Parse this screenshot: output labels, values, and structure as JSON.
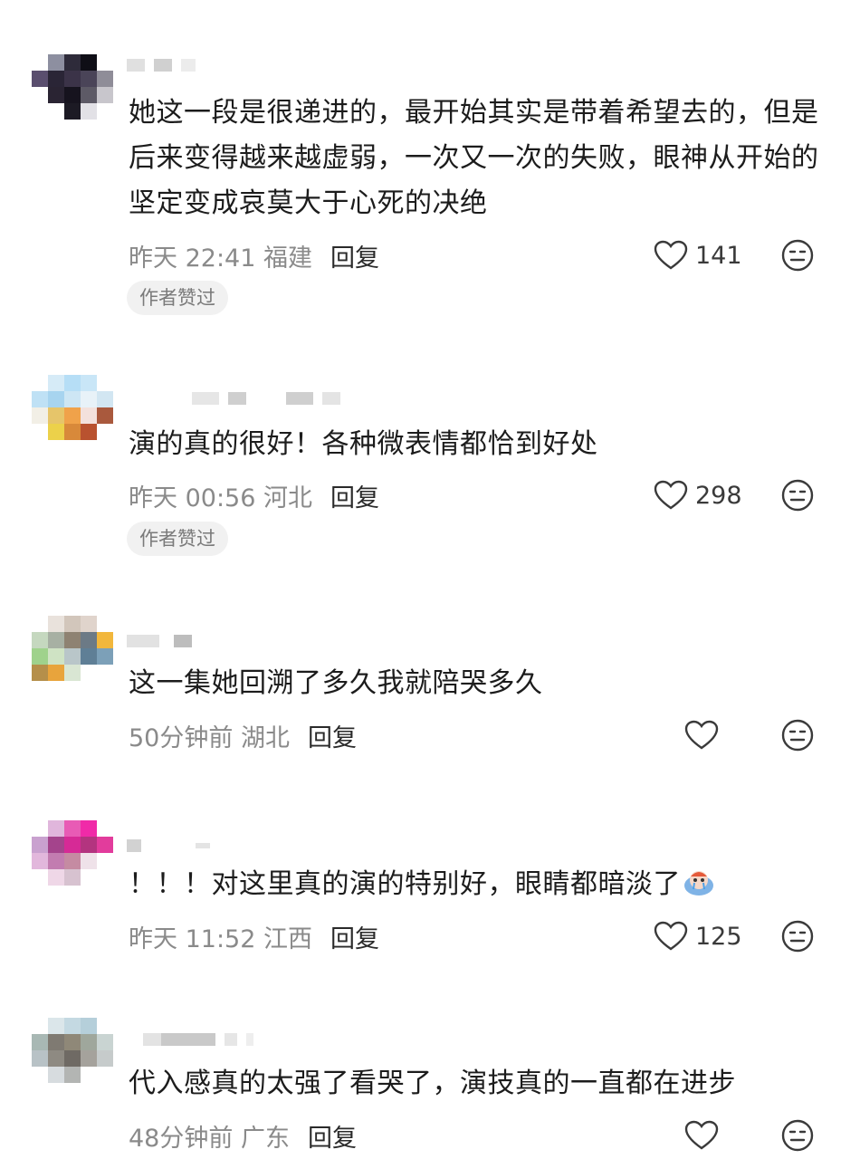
{
  "comments": [
    {
      "text": "她这一段是很递进的，最开始其实是带着希望去的，但是后来变得越来越虚弱，一次又一次的失败，眼神从开始的坚定变成哀莫大于心死的决绝",
      "time": "昨天 22:41",
      "location": "福建",
      "reply": "回复",
      "likes": "141",
      "badge": "作者赞过"
    },
    {
      "text": "演的真的很好！各种微表情都恰到好处",
      "time": "昨天 00:56",
      "location": "河北",
      "reply": "回复",
      "likes": "298",
      "badge": "作者赞过"
    },
    {
      "text": "这一集她回溯了多久我就陪哭多久",
      "time": "50分钟前",
      "location": "湖北",
      "reply": "回复",
      "likes": ""
    },
    {
      "text": "！！！对这里真的演的特别好，眼睛都暗淡了",
      "time": "昨天 11:52",
      "location": "江西",
      "reply": "回复",
      "likes": "125"
    },
    {
      "text": "代入感真的太强了看哭了，演技真的一直都在进步",
      "time": "48分钟前",
      "location": "广东",
      "reply": "回复",
      "likes": ""
    }
  ],
  "icons": {
    "like": "heart-outline-icon",
    "dislike": "neutral-face-icon",
    "avatar": "pixelated-avatar"
  },
  "colors": {
    "text": "#1c1c1c",
    "meta": "#8a8a8a",
    "badge_bg": "#f1f1f1"
  }
}
